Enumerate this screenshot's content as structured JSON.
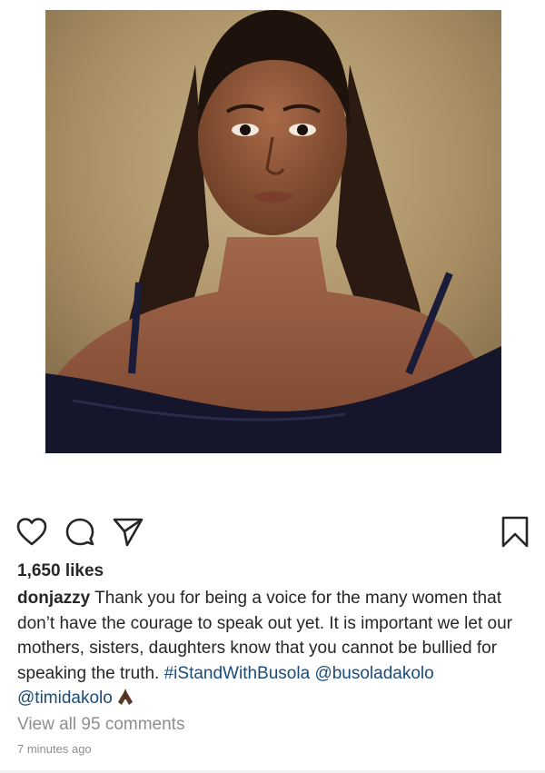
{
  "post": {
    "image": {
      "description_icon": "portrait-photo",
      "background_color": "#b59a6e"
    },
    "actions": {
      "like_icon": "heart-icon",
      "comment_icon": "comment-icon",
      "share_icon": "send-icon",
      "save_icon": "bookmark-icon"
    },
    "likes_text": "1,650 likes",
    "caption": {
      "username": "donjazzy",
      "text": " Thank you for being a voice for the many women that don’t have the courage to speak out yet. It is important we let our mothers, sisters, daughters know that you cannot be bullied for speaking the truth. ",
      "hashtag": "#iStandWithBusola",
      "mention_1": "@busoladakolo",
      "mention_2": "@timidakolo",
      "emoji_icon": "folded-hands-icon"
    },
    "view_comments_text": "View all 95 comments",
    "timestamp_text": "7 minutes ago",
    "colors": {
      "link": "#1a4b79",
      "muted": "#8e8e8e",
      "text": "#262626"
    }
  }
}
